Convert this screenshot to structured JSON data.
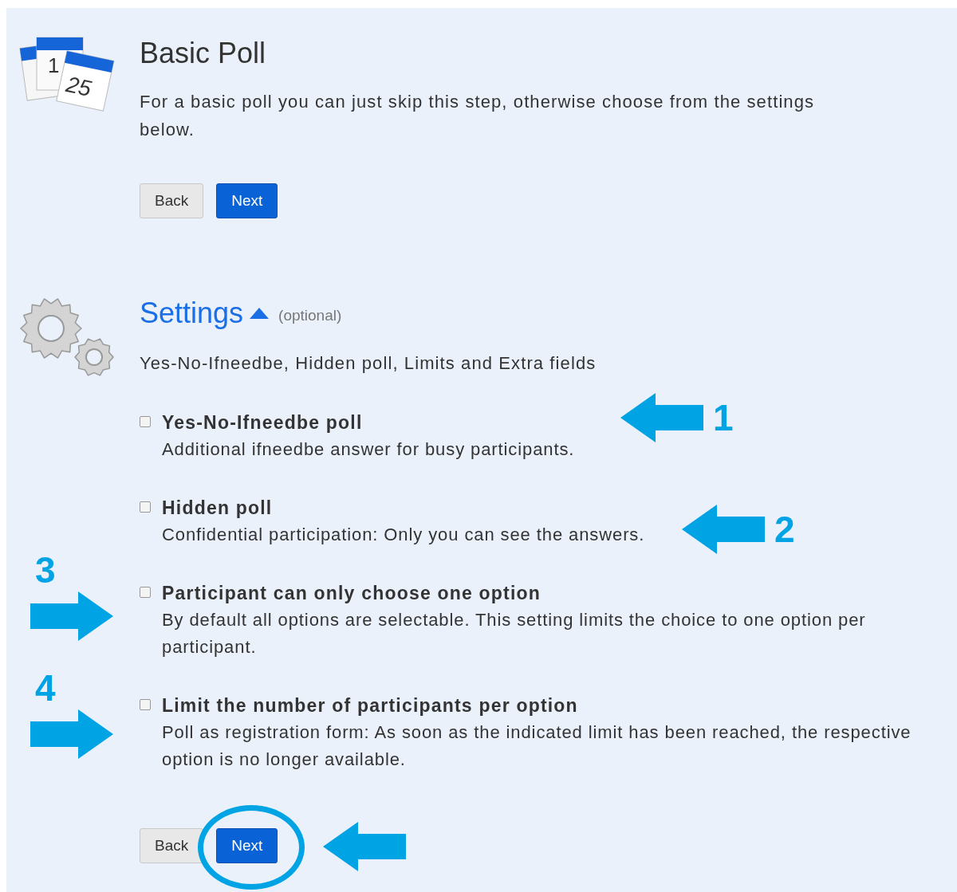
{
  "basic": {
    "title": "Basic Poll",
    "icon_dates": [
      "1",
      "25"
    ],
    "description": "For a basic poll you can just skip this step, otherwise choose from the settings below.",
    "buttons": [
      "Back",
      "Next"
    ]
  },
  "settings": {
    "title": "Settings",
    "expanded": true,
    "note": "(optional)",
    "summary": "Yes-No-Ifneedbe, Hidden poll, Limits and Extra fields",
    "options": [
      {
        "title": "Yes-No-Ifneedbe poll",
        "description": "Additional ifneedbe answer for busy participants.",
        "checked": false
      },
      {
        "title": "Hidden poll",
        "description": "Confidential participation: Only you can see the answers.",
        "checked": false
      },
      {
        "title": "Participant can only choose one option",
        "description": "By default all options are selectable. This setting limits the choice to one option per participant.",
        "checked": false
      },
      {
        "title": "Limit the number of participants per option",
        "description": "Poll as registration form: As soon as the indicated limit has been reached, the respective option is no longer available.",
        "checked": false
      }
    ],
    "buttons": [
      "Back",
      "Next"
    ]
  },
  "annotations": [
    {
      "kind": "arrow-left",
      "number": "1"
    },
    {
      "kind": "arrow-left",
      "number": "2"
    },
    {
      "kind": "arrow-right",
      "number": "3"
    },
    {
      "kind": "arrow-right",
      "number": "4"
    },
    {
      "kind": "circle"
    },
    {
      "kind": "arrow-left"
    }
  ]
}
